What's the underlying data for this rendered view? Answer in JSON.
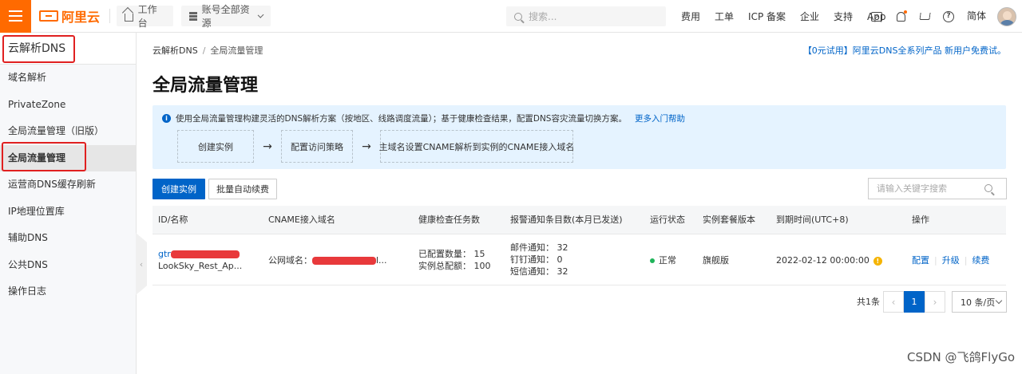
{
  "topbar": {
    "logo_text": "阿里云",
    "workbench": "工作台",
    "account_scope": "账号全部资源",
    "search_placeholder": "搜索...",
    "links": [
      "费用",
      "工单",
      "ICP 备案",
      "企业",
      "支持",
      "App"
    ],
    "lang": "简体",
    "accent": "#ff6a00"
  },
  "sidebar": {
    "title": "云解析DNS",
    "items": [
      "域名解析",
      "PrivateZone",
      "全局流量管理（旧版）",
      "全局流量管理",
      "运营商DNS缓存刷新",
      "IP地理位置库",
      "辅助DNS",
      "公共DNS",
      "操作日志"
    ],
    "active_index": 3
  },
  "main": {
    "breadcrumb": [
      "云解析DNS",
      "全局流量管理"
    ],
    "promo": "【0元试用】阿里云DNS全系列产品 新用户免费试。",
    "title": "全局流量管理",
    "tip": {
      "text": "使用全局流量管理构建灵活的DNS解析方案（按地区、线路调度流量）；基于健康检查结果，配置DNS容灾流量切换方案。",
      "link": "更多入门帮助",
      "steps": [
        "创建实例",
        "配置访问策略",
        "主域名设置CNAME解析到实例的CNAME接入域名"
      ],
      "arrow": "→"
    },
    "toolbar": {
      "create": "创建实例",
      "batch_renew": "批量自动续费",
      "keyword_placeholder": "请输入关键字搜索"
    },
    "table": {
      "headers": [
        "ID/名称",
        "CNAME接入域名",
        "健康检查任务数",
        "报警通知条目数(本月已发送)",
        "运行状态",
        "实例套餐版本",
        "到期时间(UTC+8)",
        "操作"
      ],
      "rows": [
        {
          "id_prefix": "gtr",
          "name": "LookSky_Rest_Ap...",
          "cname_label": "公网域名：",
          "cname_suffix": "l...",
          "health": [
            "已配置数量：  15",
            "实例总配额：  100"
          ],
          "alerts": [
            "邮件通知：  32",
            "钉钉通知：  0",
            "短信通知：  32"
          ],
          "status": "正常",
          "plan": "旗舰版",
          "expire": "2022-02-12 00:00:00",
          "ops": [
            "配置",
            "升级",
            "续费"
          ]
        }
      ]
    },
    "pager": {
      "total": "共1条",
      "current": "1",
      "page_size": "10 条/页"
    }
  },
  "watermark": "CSDN @飞鸽FlyGo"
}
